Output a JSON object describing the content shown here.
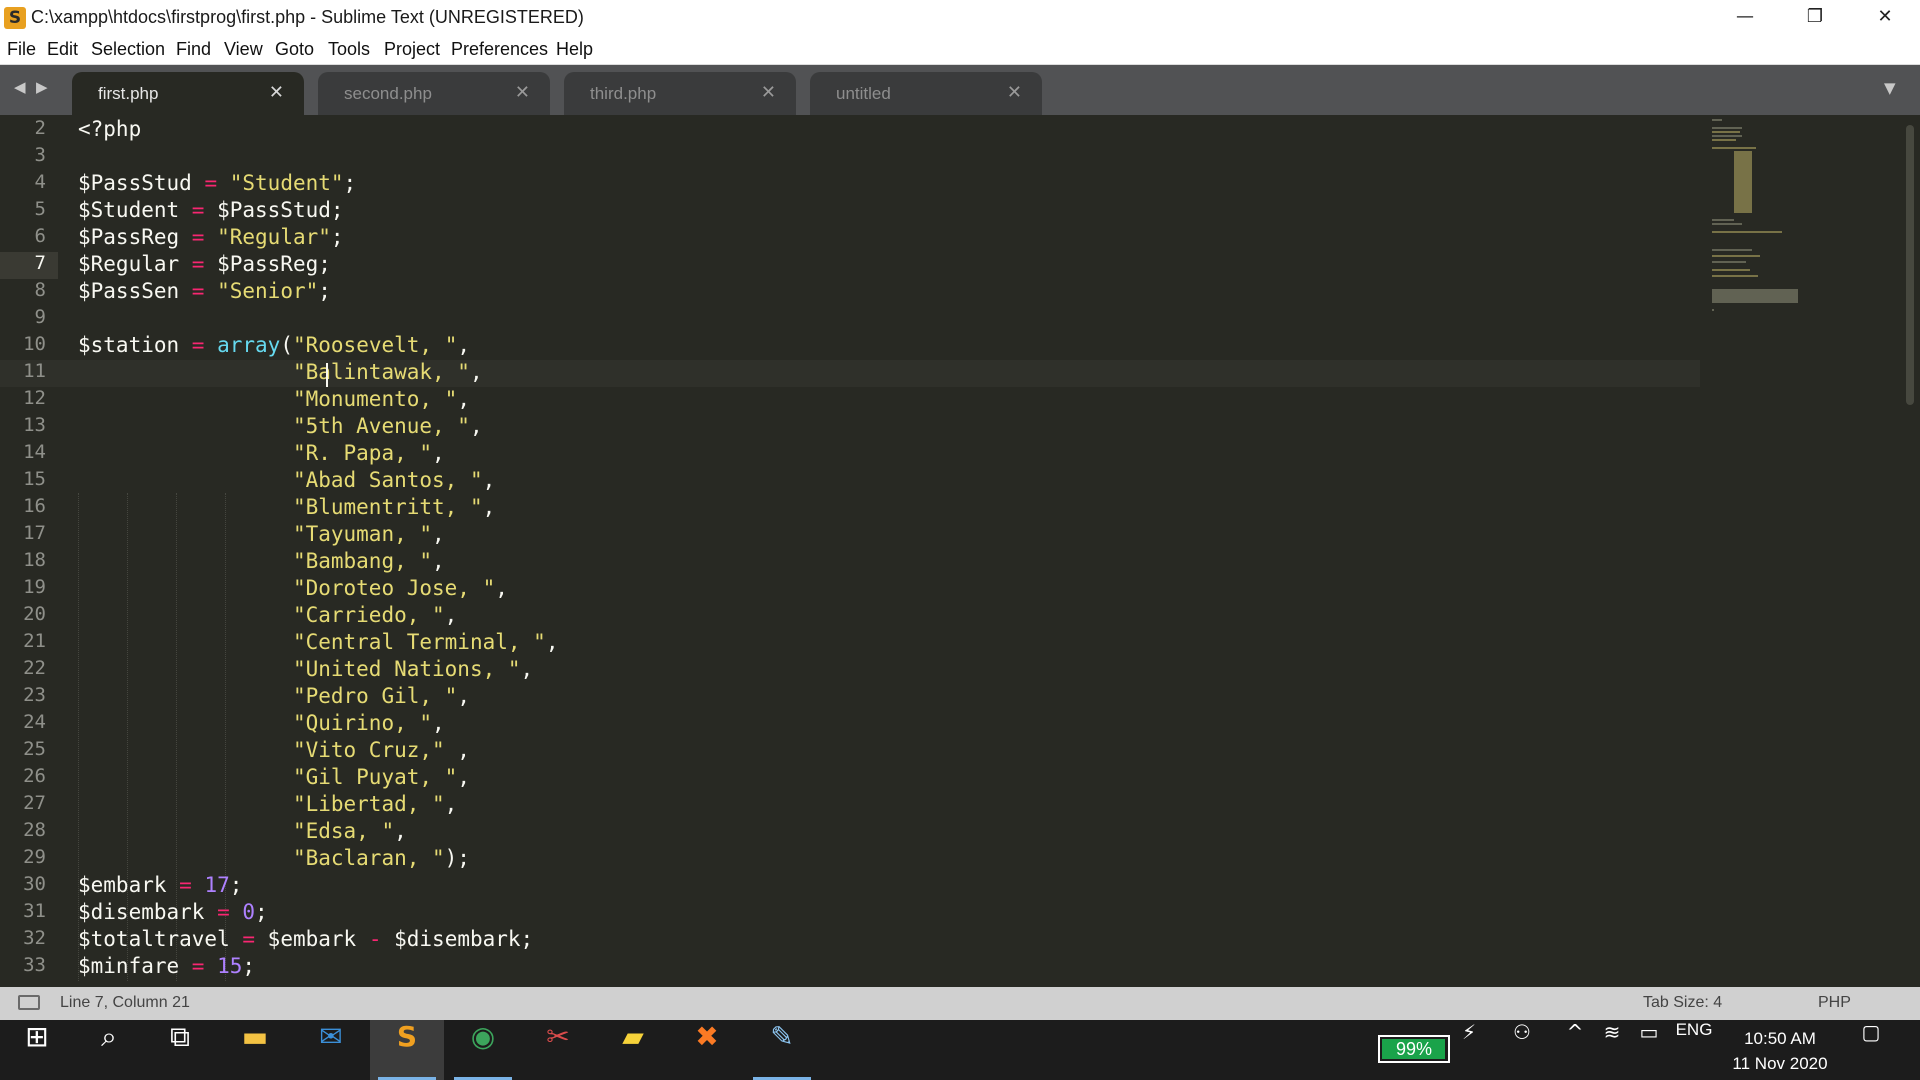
{
  "window": {
    "title": "C:\\xampp\\htdocs\\firstprog\\first.php - Sublime Text (UNREGISTERED)",
    "minimize": "—",
    "maximize": "❐",
    "close": "✕"
  },
  "menu": [
    "File",
    "Edit",
    "Selection",
    "Find",
    "View",
    "Goto",
    "Tools",
    "Project",
    "Preferences",
    "Help"
  ],
  "tabs": [
    {
      "label": "first.php",
      "active": true
    },
    {
      "label": "second.php",
      "active": false
    },
    {
      "label": "third.php",
      "active": false
    },
    {
      "label": "untitled",
      "active": false
    }
  ],
  "tab_close_glyph": "✕",
  "editor": {
    "line_numbers": [
      "2",
      "3",
      "4",
      "5",
      "6",
      "7",
      "8",
      "9",
      "10",
      "11",
      "12",
      "13",
      "14",
      "15",
      "16",
      "17",
      "18",
      "19",
      "20",
      "21",
      "22",
      "23",
      "24",
      "25",
      "26",
      "27",
      "28",
      "29",
      "30",
      "31",
      "32",
      "33"
    ],
    "current_line": "7",
    "lines": [
      [
        {
          "t": "<?php"
        }
      ],
      [],
      [
        {
          "t": "$PassStud "
        },
        {
          "t": "=",
          "c": "op"
        },
        {
          "t": " "
        },
        {
          "t": "\"Student\"",
          "c": "str"
        },
        {
          "t": ";"
        }
      ],
      [
        {
          "t": "$Student "
        },
        {
          "t": "=",
          "c": "op"
        },
        {
          "t": " $PassStud;"
        }
      ],
      [
        {
          "t": "$PassReg "
        },
        {
          "t": "=",
          "c": "op"
        },
        {
          "t": " "
        },
        {
          "t": "\"Regular\"",
          "c": "str"
        },
        {
          "t": ";"
        }
      ],
      [
        {
          "t": "$Regular "
        },
        {
          "t": "=",
          "c": "op"
        },
        {
          "t": " $PassReg;"
        }
      ],
      [
        {
          "t": "$PassSen "
        },
        {
          "t": "=",
          "c": "op"
        },
        {
          "t": " "
        },
        {
          "t": "\"Senior\"",
          "c": "str"
        },
        {
          "t": ";"
        }
      ],
      [],
      [
        {
          "t": "$station "
        },
        {
          "t": "=",
          "c": "op"
        },
        {
          "t": " "
        },
        {
          "t": "array",
          "c": "fn"
        },
        {
          "t": "("
        },
        {
          "t": "\"Roosevelt, \"",
          "c": "str"
        },
        {
          "t": ","
        }
      ],
      [
        {
          "t": "                 "
        },
        {
          "t": "\"Balintawak, \"",
          "c": "str"
        },
        {
          "t": ","
        }
      ],
      [
        {
          "t": "                 "
        },
        {
          "t": "\"Monumento, \"",
          "c": "str"
        },
        {
          "t": ","
        }
      ],
      [
        {
          "t": "                 "
        },
        {
          "t": "\"5th Avenue, \"",
          "c": "str"
        },
        {
          "t": ","
        }
      ],
      [
        {
          "t": "                 "
        },
        {
          "t": "\"R. Papa, \"",
          "c": "str"
        },
        {
          "t": ","
        }
      ],
      [
        {
          "t": "                 "
        },
        {
          "t": "\"Abad Santos, \"",
          "c": "str"
        },
        {
          "t": ","
        }
      ],
      [
        {
          "t": "                 "
        },
        {
          "t": "\"Blumentritt, \"",
          "c": "str"
        },
        {
          "t": ","
        }
      ],
      [
        {
          "t": "                 "
        },
        {
          "t": "\"Tayuman, \"",
          "c": "str"
        },
        {
          "t": ","
        }
      ],
      [
        {
          "t": "                 "
        },
        {
          "t": "\"Bambang, \"",
          "c": "str"
        },
        {
          "t": ","
        }
      ],
      [
        {
          "t": "                 "
        },
        {
          "t": "\"Doroteo Jose, \"",
          "c": "str"
        },
        {
          "t": ","
        }
      ],
      [
        {
          "t": "                 "
        },
        {
          "t": "\"Carriedo, \"",
          "c": "str"
        },
        {
          "t": ","
        }
      ],
      [
        {
          "t": "                 "
        },
        {
          "t": "\"Central Terminal, \"",
          "c": "str"
        },
        {
          "t": ","
        }
      ],
      [
        {
          "t": "                 "
        },
        {
          "t": "\"United Nations, \"",
          "c": "str"
        },
        {
          "t": ","
        }
      ],
      [
        {
          "t": "                 "
        },
        {
          "t": "\"Pedro Gil, \"",
          "c": "str"
        },
        {
          "t": ","
        }
      ],
      [
        {
          "t": "                 "
        },
        {
          "t": "\"Quirino, \"",
          "c": "str"
        },
        {
          "t": ","
        }
      ],
      [
        {
          "t": "                 "
        },
        {
          "t": "\"Vito Cruz,\"",
          "c": "str"
        },
        {
          "t": " ,"
        }
      ],
      [
        {
          "t": "                 "
        },
        {
          "t": "\"Gil Puyat, \"",
          "c": "str"
        },
        {
          "t": ","
        }
      ],
      [
        {
          "t": "                 "
        },
        {
          "t": "\"Libertad, \"",
          "c": "str"
        },
        {
          "t": ","
        }
      ],
      [
        {
          "t": "                 "
        },
        {
          "t": "\"Edsa, \"",
          "c": "str"
        },
        {
          "t": ","
        }
      ],
      [
        {
          "t": "                 "
        },
        {
          "t": "\"Baclaran, \"",
          "c": "str"
        },
        {
          "t": ");"
        }
      ],
      [
        {
          "t": "$embark "
        },
        {
          "t": "=",
          "c": "op"
        },
        {
          "t": " "
        },
        {
          "t": "17",
          "c": "num"
        },
        {
          "t": ";"
        }
      ],
      [
        {
          "t": "$disembark "
        },
        {
          "t": "=",
          "c": "op"
        },
        {
          "t": " "
        },
        {
          "t": "0",
          "c": "num"
        },
        {
          "t": ";"
        }
      ],
      [
        {
          "t": "$totaltravel "
        },
        {
          "t": "=",
          "c": "op"
        },
        {
          "t": " $embark "
        },
        {
          "t": "-",
          "c": "op"
        },
        {
          "t": " $disembark;"
        }
      ],
      [
        {
          "t": "$minfare "
        },
        {
          "t": "=",
          "c": "op"
        },
        {
          "t": " "
        },
        {
          "t": "15",
          "c": "num"
        },
        {
          "t": ";"
        }
      ]
    ]
  },
  "status": {
    "position": "Line 7, Column 21",
    "tab_size": "Tab Size: 4",
    "syntax": "PHP"
  },
  "taskbar": {
    "apps": [
      {
        "name": "start-button",
        "glyph": "⊞"
      },
      {
        "name": "search-icon",
        "glyph": "⌕"
      },
      {
        "name": "task-view-icon",
        "glyph": "⧉"
      },
      {
        "name": "file-explorer-icon",
        "glyph": "▬"
      },
      {
        "name": "mail-icon",
        "glyph": "✉"
      },
      {
        "name": "sublime-text-icon",
        "glyph": "S"
      },
      {
        "name": "chrome-icon",
        "glyph": "◉"
      },
      {
        "name": "snipping-tool-icon",
        "glyph": "✂"
      },
      {
        "name": "sticky-notes-icon",
        "glyph": "▰"
      },
      {
        "name": "xampp-icon",
        "glyph": "✖"
      },
      {
        "name": "paint-icon",
        "glyph": "✎"
      }
    ],
    "battery_percent": "99%",
    "battery_level": 0.99,
    "tray_power": "⚡",
    "tray_people": "⚇",
    "tray_chevron": "^",
    "tray_wifi": "≋",
    "tray_keyboard": "▭",
    "language": "ENG",
    "time": "10:50 AM",
    "date": "11 Nov 2020",
    "notifications": "▢"
  },
  "colors": {
    "editor_bg": "#282923",
    "tab_bar_bg": "#515254",
    "string": "#e6db74",
    "operator": "#f92672",
    "number": "#ae81ff",
    "function": "#66d9ef",
    "status_bar_bg": "#d0d0d0",
    "battery_green": "#1aa34a"
  }
}
